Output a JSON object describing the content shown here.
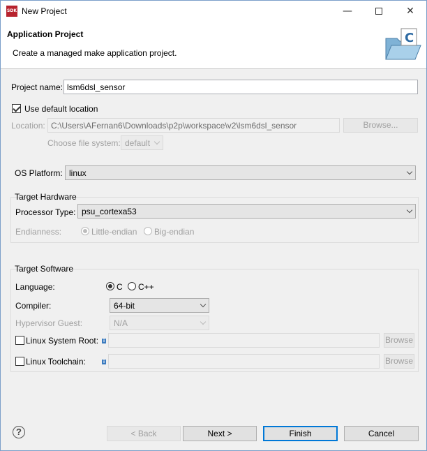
{
  "titlebar": {
    "app_icon_text": "SDK",
    "title": "New Project",
    "minimize_icon": "minimize-icon",
    "maximize_icon": "maximize-icon",
    "close_icon": "close-icon"
  },
  "header": {
    "title": "Application Project",
    "description": "Create a managed make application project."
  },
  "form": {
    "project_name_label": "Project name:",
    "project_name_value": "lsm6dsl_sensor",
    "use_default_location_label": "Use default location",
    "use_default_location_checked": true,
    "location_label": "Location:",
    "location_value": "C:\\Users\\AFernan6\\Downloads\\p2p\\workspace\\v2\\lsm6dsl_sensor",
    "browse_label": "Browse...",
    "file_system_label": "Choose file system:",
    "file_system_value": "default",
    "os_platform_label": "OS Platform:",
    "os_platform_value": "linux"
  },
  "target_hardware": {
    "title": "Target Hardware",
    "processor_label": "Processor Type:",
    "processor_value": "psu_cortexa53",
    "endianness_label": "Endianness:",
    "little_endian_label": "Little-endian",
    "big_endian_label": "Big-endian",
    "selected": "Little-endian"
  },
  "target_software": {
    "title": "Target Software",
    "language_label": "Language:",
    "lang_c_label": "C",
    "lang_cpp_label": "C++",
    "selected_language": "C",
    "compiler_label": "Compiler:",
    "compiler_value": "64-bit",
    "hypervisor_label": "Hypervisor Guest:",
    "hypervisor_value": "N/A",
    "sysroot_label": "Linux System Root:",
    "toolchain_label": "Linux Toolchain:",
    "browse_label": "Browse"
  },
  "footer": {
    "help_icon": "help-icon",
    "back_label": "< Back",
    "next_label": "Next >",
    "finish_label": "Finish",
    "cancel_label": "Cancel"
  },
  "colors": {
    "window_bg": "#f0f0f0",
    "accent_border": "#0078d7",
    "app_icon_bg": "#b8232e"
  }
}
